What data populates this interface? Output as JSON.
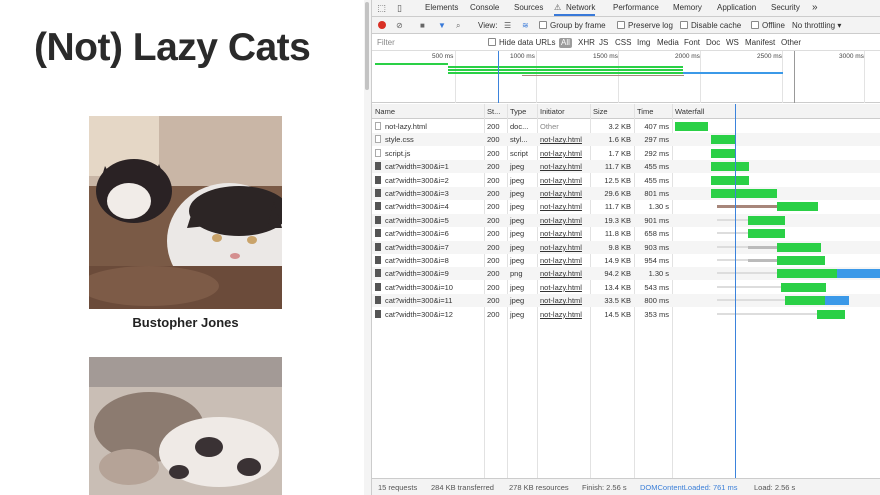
{
  "page": {
    "title": "(Not) Lazy Cats",
    "cats": [
      {
        "caption": "Bustopher Jones"
      },
      {
        "caption": ""
      }
    ]
  },
  "devtools": {
    "tabs": [
      "Elements",
      "Console",
      "Sources",
      "Network",
      "Performance",
      "Memory",
      "Application",
      "Security"
    ],
    "more": "»",
    "active_tab": "Network",
    "toolbar": {
      "view_label": "View:",
      "group_by_frame": "Group by frame",
      "preserve_log": "Preserve log",
      "disable_cache": "Disable cache",
      "offline": "Offline",
      "throttling": "No throttling"
    },
    "filter": {
      "placeholder": "Filter",
      "hide_data_urls": "Hide data URLs",
      "types": [
        "All",
        "XHR",
        "JS",
        "CSS",
        "Img",
        "Media",
        "Font",
        "Doc",
        "WS",
        "Manifest",
        "Other"
      ]
    },
    "overview_ticks": [
      "500 ms",
      "1000 ms",
      "1500 ms",
      "2000 ms",
      "2500 ms",
      "3000 ms"
    ],
    "columns": [
      "Name",
      "St...",
      "Type",
      "Initiator",
      "Size",
      "Time",
      "Waterfall"
    ],
    "requests": [
      {
        "name": "not-lazy.html",
        "status": "200",
        "type": "doc...",
        "initiator": "Other",
        "size": "3.2 KB",
        "time": "407 ms",
        "icon": "doc"
      },
      {
        "name": "style.css",
        "status": "200",
        "type": "styl...",
        "initiator": "not-lazy.html",
        "size": "1.6 KB",
        "time": "297 ms",
        "icon": "doc"
      },
      {
        "name": "script.js",
        "status": "200",
        "type": "script",
        "initiator": "not-lazy.html",
        "size": "1.7 KB",
        "time": "292 ms",
        "icon": "doc"
      },
      {
        "name": "cat?width=300&i=1",
        "status": "200",
        "type": "jpeg",
        "initiator": "not-lazy.html",
        "size": "11.7 KB",
        "time": "455 ms",
        "icon": "img"
      },
      {
        "name": "cat?width=300&i=2",
        "status": "200",
        "type": "jpeg",
        "initiator": "not-lazy.html",
        "size": "12.5 KB",
        "time": "455 ms",
        "icon": "img"
      },
      {
        "name": "cat?width=300&i=3",
        "status": "200",
        "type": "jpeg",
        "initiator": "not-lazy.html",
        "size": "29.6 KB",
        "time": "801 ms",
        "icon": "img"
      },
      {
        "name": "cat?width=300&i=4",
        "status": "200",
        "type": "jpeg",
        "initiator": "not-lazy.html",
        "size": "11.7 KB",
        "time": "1.30 s",
        "icon": "img"
      },
      {
        "name": "cat?width=300&i=5",
        "status": "200",
        "type": "jpeg",
        "initiator": "not-lazy.html",
        "size": "19.3 KB",
        "time": "901 ms",
        "icon": "img"
      },
      {
        "name": "cat?width=300&i=6",
        "status": "200",
        "type": "jpeg",
        "initiator": "not-lazy.html",
        "size": "11.8 KB",
        "time": "658 ms",
        "icon": "img"
      },
      {
        "name": "cat?width=300&i=7",
        "status": "200",
        "type": "jpeg",
        "initiator": "not-lazy.html",
        "size": "9.8 KB",
        "time": "903 ms",
        "icon": "img"
      },
      {
        "name": "cat?width=300&i=8",
        "status": "200",
        "type": "jpeg",
        "initiator": "not-lazy.html",
        "size": "14.9 KB",
        "time": "954 ms",
        "icon": "img"
      },
      {
        "name": "cat?width=300&i=9",
        "status": "200",
        "type": "png",
        "initiator": "not-lazy.html",
        "size": "94.2 KB",
        "time": "1.30 s",
        "icon": "img"
      },
      {
        "name": "cat?width=300&i=10",
        "status": "200",
        "type": "jpeg",
        "initiator": "not-lazy.html",
        "size": "13.4 KB",
        "time": "543 ms",
        "icon": "img"
      },
      {
        "name": "cat?width=300&i=11",
        "status": "200",
        "type": "jpeg",
        "initiator": "not-lazy.html",
        "size": "33.5 KB",
        "time": "800 ms",
        "icon": "img"
      },
      {
        "name": "cat?width=300&i=12",
        "status": "200",
        "type": "jpeg",
        "initiator": "not-lazy.html",
        "size": "14.5 KB",
        "time": "353 ms",
        "icon": "img"
      }
    ],
    "status_bar": {
      "requests": "15 requests",
      "transferred": "284 KB transferred",
      "resources": "278 KB resources",
      "finish": "Finish: 2.56 s",
      "dom_loaded": "DOMContentLoaded: 761 ms",
      "load": "Load: 2.56 s"
    },
    "colors": {
      "accent": "#3879d9",
      "waterfall_green": "#2ad046",
      "waterfall_blue": "#3b99e8",
      "record_red": "#d93025"
    }
  }
}
